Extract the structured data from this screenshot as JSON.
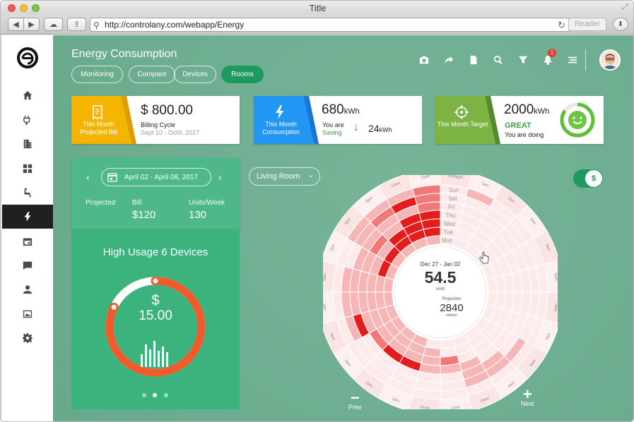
{
  "window": {
    "title": "Title",
    "url": "http://controlany.com/webapp/Energy",
    "reader_label": "Reader"
  },
  "sidebar": {
    "items": [
      {
        "icon": "home-icon",
        "active": false
      },
      {
        "icon": "plug-icon",
        "active": false
      },
      {
        "icon": "building-icon",
        "active": false
      },
      {
        "icon": "grid-icon",
        "active": false
      },
      {
        "icon": "faucet-icon",
        "active": false
      },
      {
        "icon": "lightning-icon",
        "active": true
      },
      {
        "icon": "calendar-icon",
        "active": false
      },
      {
        "icon": "chat-icon",
        "active": false
      },
      {
        "icon": "user-icon",
        "active": false
      },
      {
        "icon": "image-icon",
        "active": false
      },
      {
        "icon": "settings-icon",
        "active": false
      }
    ]
  },
  "header": {
    "title": "Energy Consumption",
    "tabs": [
      {
        "label": "Monitoring",
        "active": false
      },
      {
        "label": "Compare",
        "active": false
      },
      {
        "label": "Devices",
        "active": false
      },
      {
        "label": "Rooms",
        "active": true
      }
    ],
    "notification_count": "1",
    "icons": [
      "camera-icon",
      "share-icon",
      "document-icon",
      "search-icon",
      "filter-icon",
      "bell-icon",
      "menu-icon"
    ]
  },
  "cards": {
    "bill": {
      "label": "This Month Projected Bill",
      "value": "$ 800.00",
      "title": "Billing Cycle",
      "subtitle": "Sept 10 - Oct9, 2017",
      "color": "#f5b400"
    },
    "consumption": {
      "label": "This Month Consumption",
      "value": "680",
      "unit": "kWh",
      "saving_line1": "You are",
      "saving_line2": "Saving",
      "saving_value": "24",
      "saving_unit": "kWh",
      "color": "#2196f3"
    },
    "target": {
      "label": "This Month Target",
      "value": "2000",
      "unit": "kWh",
      "status": "GREAT",
      "status_sub": "You are doing",
      "color": "#7cb342",
      "progress": 0.85
    }
  },
  "left_panel": {
    "date_range": "April 02 - April 08, 2017",
    "stats": [
      {
        "label": "Projected",
        "value": ""
      },
      {
        "label": "Bill",
        "value": "$120"
      },
      {
        "label": "Units/Week",
        "value": "130"
      }
    ],
    "devices_title": "High Usage 6 Devices",
    "currency": "$",
    "amount": "15.00",
    "ring_progress": 0.82,
    "carousel_pages": 3,
    "carousel_active": 1
  },
  "room": {
    "selected": "Living Room"
  },
  "toggle": {
    "label": "$",
    "on": true
  },
  "radial": {
    "date_range": "Dec 27 - Jan 02",
    "value": "54.5",
    "value_unit": "units",
    "projection_label": "Projection",
    "projection_value": "2840",
    "projection_unit": "units/yr",
    "day_labels": [
      "Sun",
      "Sat",
      "Fri",
      "Thu",
      "Wed",
      "Tue",
      "Mon"
    ],
    "hour_labels": [
      "Midnight",
      "1am",
      "2am",
      "3am",
      "4am",
      "5am",
      "6am",
      "7am",
      "8am",
      "9am",
      "10am",
      "11am",
      "Noon",
      "1pm",
      "2pm",
      "3pm",
      "4pm",
      "5pm",
      "6pm",
      "7pm",
      "8pm",
      "9pm",
      "10pm",
      "11pm"
    ],
    "heat": [
      [
        0,
        1,
        0,
        0,
        0,
        0,
        0,
        0,
        0,
        0,
        0,
        0,
        0,
        0,
        0,
        0,
        0,
        0,
        0,
        0,
        1,
        1,
        1,
        2
      ],
      [
        0,
        0,
        0,
        0,
        0,
        0,
        0,
        0,
        1,
        1,
        1,
        0,
        0,
        0,
        0,
        0,
        1,
        1,
        1,
        0,
        1,
        2,
        3,
        2
      ],
      [
        0,
        0,
        0,
        0,
        0,
        0,
        0,
        0,
        0,
        1,
        1,
        0,
        0,
        0,
        0,
        0,
        3,
        1,
        1,
        1,
        1,
        1,
        1,
        2
      ],
      [
        0,
        0,
        0,
        0,
        0,
        0,
        0,
        0,
        0,
        0,
        1,
        1,
        1,
        3,
        3,
        2,
        1,
        1,
        1,
        1,
        2,
        1,
        3,
        3
      ],
      [
        0,
        0,
        0,
        0,
        0,
        0,
        0,
        0,
        0,
        0,
        0,
        2,
        1,
        1,
        1,
        1,
        1,
        1,
        1,
        1,
        1,
        3,
        3,
        3
      ],
      [
        0,
        0,
        0,
        0,
        0,
        0,
        0,
        0,
        0,
        0,
        0,
        0,
        1,
        1,
        1,
        1,
        1,
        1,
        1,
        3,
        3,
        3,
        3,
        3
      ],
      [
        0,
        0,
        0,
        0,
        0,
        0,
        0,
        0,
        0,
        0,
        0,
        0,
        0,
        1,
        1,
        1,
        1,
        1,
        1,
        1,
        1,
        1,
        1,
        1
      ]
    ],
    "heat_colors": [
      "#fdeaea",
      "#f7b6b6",
      "#f07a7a",
      "#e51c1c"
    ],
    "prev_label": "Prev",
    "next_label": "Next"
  }
}
